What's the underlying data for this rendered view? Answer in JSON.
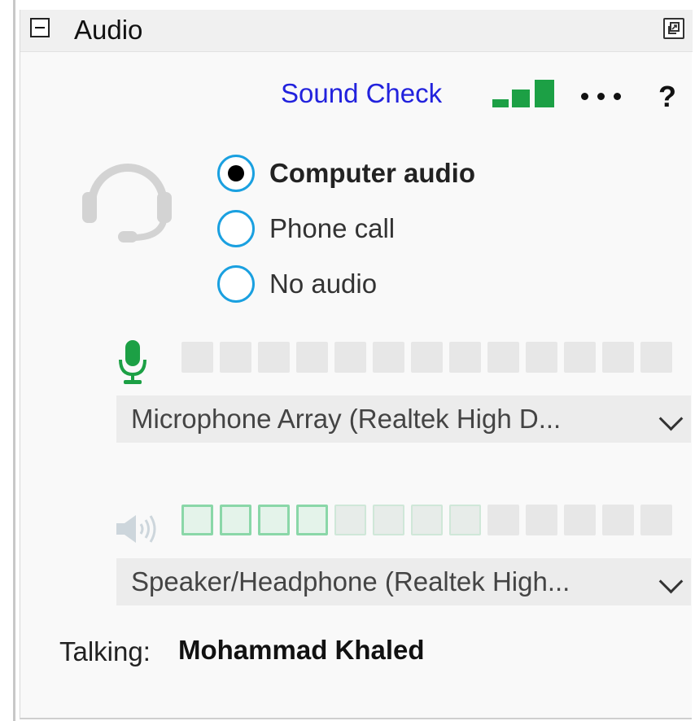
{
  "panel": {
    "title": "Audio"
  },
  "toolbar": {
    "sound_check_label": "Sound Check",
    "help_label": "?"
  },
  "audio_options": [
    {
      "label": "Computer audio",
      "selected": true
    },
    {
      "label": "Phone call",
      "selected": false
    },
    {
      "label": "No audio",
      "selected": false
    }
  ],
  "microphone": {
    "device": "Microphone Array (Realtek High D...",
    "level_segments_total": 13,
    "level_segments_active": 0
  },
  "speaker": {
    "device": "Speaker/Headphone (Realtek High...",
    "level_segments_total": 13,
    "level_segments_active": 8
  },
  "talking": {
    "label": "Talking:",
    "name": "Mohammad Khaled"
  },
  "colors": {
    "link": "#2222dd",
    "signal": "#1ca045",
    "radio_ring": "#1aa0e0",
    "mic": "#1ca045"
  },
  "icons": [
    "collapse-icon",
    "popout-icon",
    "signal-bars-icon",
    "more-options-icon",
    "help-icon",
    "headset-icon",
    "microphone-icon",
    "speaker-icon",
    "chevron-down-icon"
  ]
}
